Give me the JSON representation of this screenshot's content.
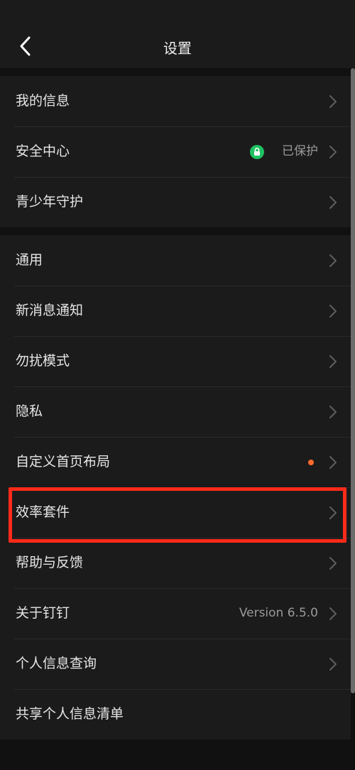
{
  "header": {
    "title": "设置",
    "back_icon": "chevron-left-icon"
  },
  "groups": [
    {
      "items": [
        {
          "label": "我的信息"
        },
        {
          "label": "安全中心",
          "status": "已保护",
          "status_icon": "lock-icon",
          "status_color": "#1fc262"
        },
        {
          "label": "青少年守护"
        }
      ]
    },
    {
      "items": [
        {
          "label": "通用"
        },
        {
          "label": "新消息通知"
        },
        {
          "label": "勿扰模式"
        },
        {
          "label": "隐私"
        },
        {
          "label": "自定义首页布局",
          "badge_color": "#ff6a2c"
        },
        {
          "label": "效率套件"
        },
        {
          "label": "帮助与反馈"
        },
        {
          "label": "关于钉钉",
          "value": "Version 6.5.0"
        },
        {
          "label": "个人信息查询"
        },
        {
          "label": "共享个人信息清单"
        }
      ]
    }
  ],
  "highlight_color": "#ff2a1a"
}
